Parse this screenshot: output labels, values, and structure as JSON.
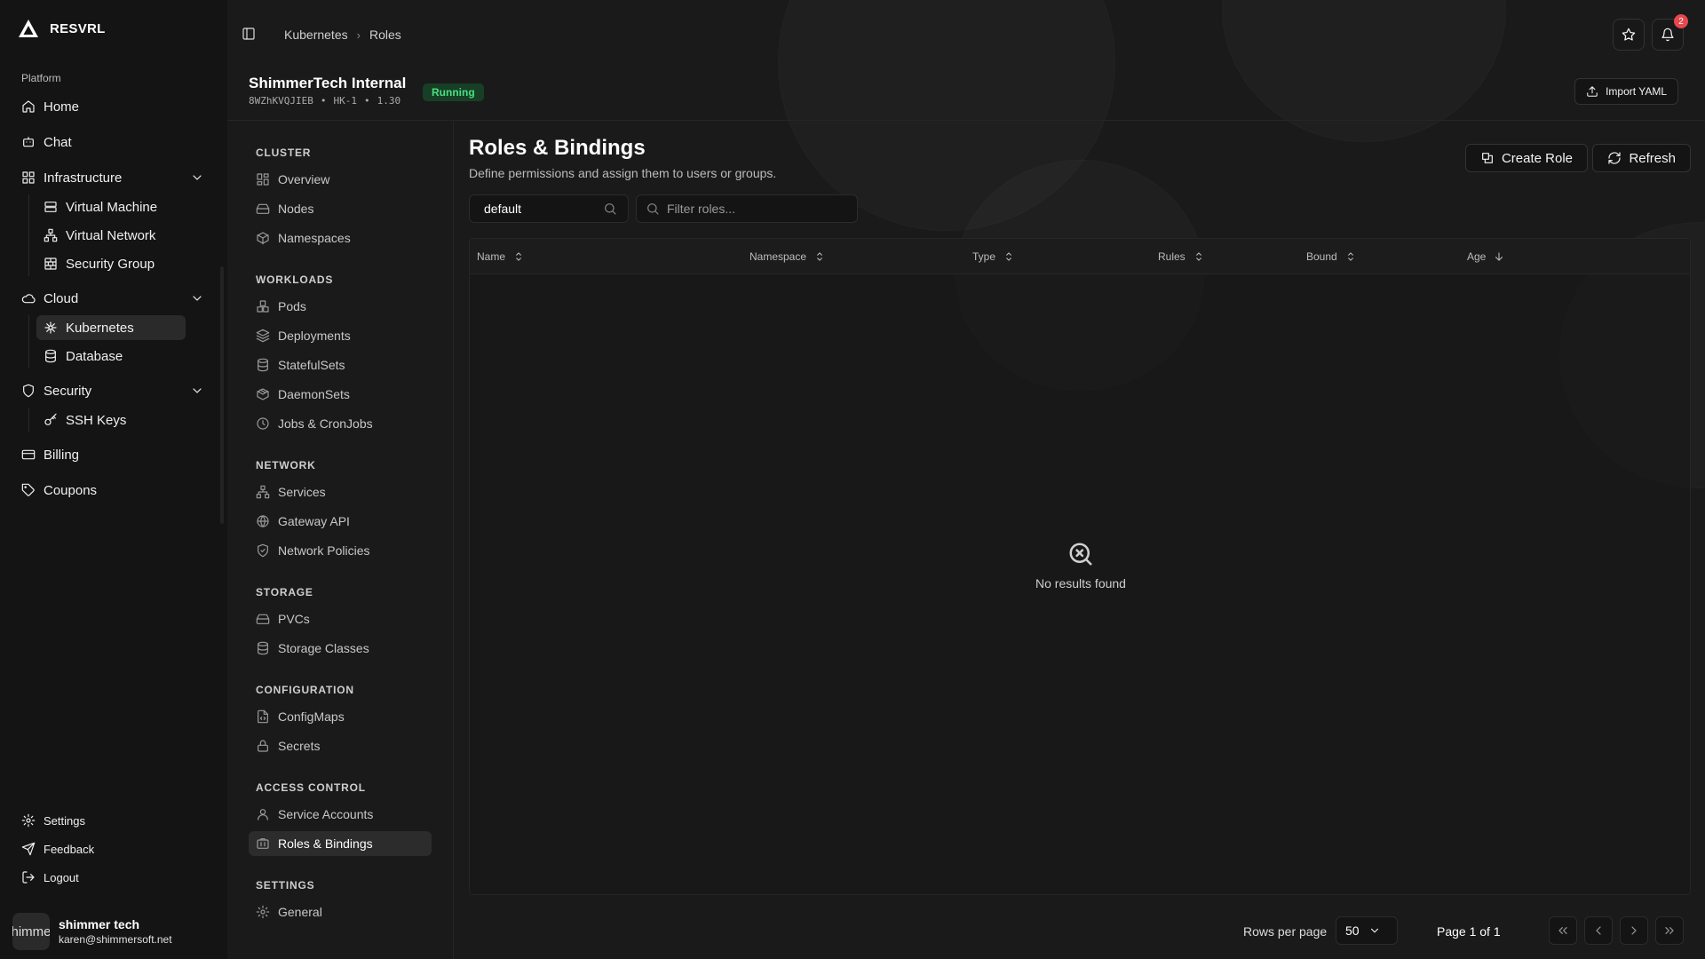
{
  "brand": {
    "name": "RESVRL",
    "icon": "triangle-logo-icon"
  },
  "sidebar": {
    "group_label": "Platform",
    "items": [
      {
        "label": "Home",
        "icon": "home-icon"
      },
      {
        "label": "Chat",
        "icon": "chat-icon"
      },
      {
        "label": "Infrastructure",
        "icon": "grid-icon",
        "expanded": true,
        "children": [
          {
            "label": "Virtual Machine",
            "icon": "server-icon"
          },
          {
            "label": "Virtual Network",
            "icon": "network-icon"
          },
          {
            "label": "Security Group",
            "icon": "brick-wall-icon"
          }
        ]
      },
      {
        "label": "Cloud",
        "icon": "cloud-icon",
        "expanded": true,
        "children": [
          {
            "label": "Kubernetes",
            "icon": "helm-icon",
            "active": true
          },
          {
            "label": "Database",
            "icon": "database-icon"
          }
        ]
      },
      {
        "label": "Security",
        "icon": "shield-icon",
        "expanded": true,
        "children": [
          {
            "label": "SSH Keys",
            "icon": "key-icon"
          }
        ]
      },
      {
        "label": "Billing",
        "icon": "credit-card-icon"
      },
      {
        "label": "Coupons",
        "icon": "tag-icon"
      }
    ],
    "footer": [
      {
        "label": "Settings",
        "icon": "gear-icon"
      },
      {
        "label": "Feedback",
        "icon": "send-icon"
      },
      {
        "label": "Logout",
        "icon": "logout-icon"
      }
    ],
    "user": {
      "avatar_text": "himme",
      "name": "shimmer tech",
      "email": "karen@shimmersoft.net"
    }
  },
  "topbar": {
    "breadcrumb": [
      "Kubernetes",
      "Roles"
    ],
    "notification_count": "2"
  },
  "cluster": {
    "name": "ShimmerTech Internal",
    "id": "8WZhKVQJIEB",
    "region": "HK-1",
    "version": "1.30",
    "status": "Running",
    "status_color": "#4ade80",
    "import_label": "Import YAML"
  },
  "subnav": {
    "sections": [
      {
        "title": "CLUSTER",
        "items": [
          {
            "label": "Overview",
            "icon": "layout-icon"
          },
          {
            "label": "Nodes",
            "icon": "hard-drive-icon"
          },
          {
            "label": "Namespaces",
            "icon": "box-icon"
          }
        ]
      },
      {
        "title": "WORKLOADS",
        "items": [
          {
            "label": "Pods",
            "icon": "boxes-icon"
          },
          {
            "label": "Deployments",
            "icon": "layers-icon"
          },
          {
            "label": "StatefulSets",
            "icon": "database-icon"
          },
          {
            "label": "DaemonSets",
            "icon": "package-icon"
          },
          {
            "label": "Jobs & CronJobs",
            "icon": "clock-icon"
          }
        ]
      },
      {
        "title": "NETWORK",
        "items": [
          {
            "label": "Services",
            "icon": "network-icon"
          },
          {
            "label": "Gateway API",
            "icon": "globe-icon"
          },
          {
            "label": "Network Policies",
            "icon": "shield-check-icon"
          }
        ]
      },
      {
        "title": "STORAGE",
        "items": [
          {
            "label": "PVCs",
            "icon": "hard-drive-icon"
          },
          {
            "label": "Storage Classes",
            "icon": "database-icon"
          }
        ]
      },
      {
        "title": "CONFIGURATION",
        "items": [
          {
            "label": "ConfigMaps",
            "icon": "file-code-icon"
          },
          {
            "label": "Secrets",
            "icon": "lock-icon"
          }
        ]
      },
      {
        "title": "ACCESS CONTROL",
        "items": [
          {
            "label": "Service Accounts",
            "icon": "user-icon"
          },
          {
            "label": "Roles & Bindings",
            "icon": "id-badge-icon",
            "active": true
          }
        ]
      },
      {
        "title": "SETTINGS",
        "items": [
          {
            "label": "General",
            "icon": "gear-icon"
          }
        ]
      }
    ]
  },
  "page": {
    "title": "Roles & Bindings",
    "description": "Define permissions and assign them to users or groups.",
    "create_label": "Create Role",
    "refresh_label": "Refresh",
    "namespace_value": "default",
    "filter_placeholder": "Filter roles..."
  },
  "table": {
    "columns": [
      "Name",
      "Namespace",
      "Type",
      "Rules",
      "Bound",
      "Age"
    ],
    "sorted_column": "Age",
    "sort_direction": "descending",
    "rows": [],
    "empty_text": "No results found"
  },
  "pagination": {
    "rows_per_page_label": "Rows per page",
    "rows_per_page": "50",
    "page_info": "Page 1 of 1"
  }
}
